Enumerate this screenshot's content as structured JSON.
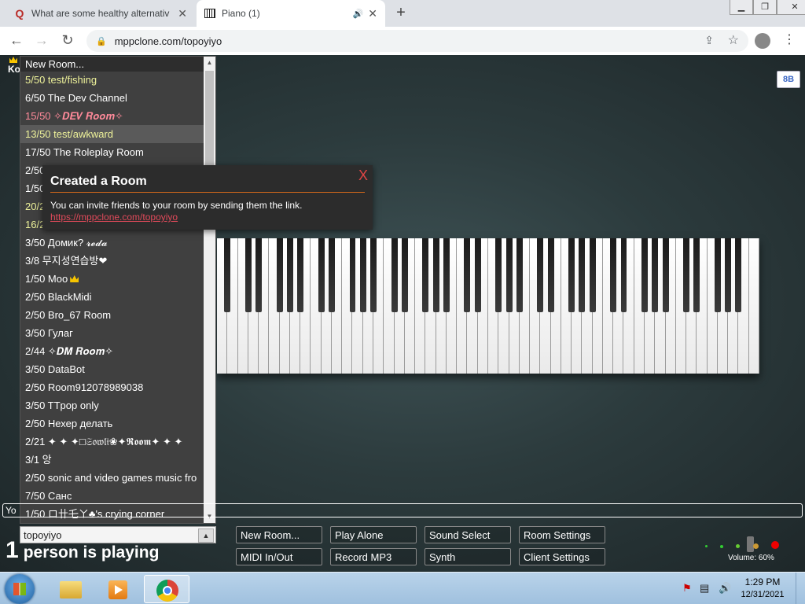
{
  "browser": {
    "tabs": [
      {
        "title": "What are some healthy alternativ",
        "icon": "quora-icon",
        "active": false
      },
      {
        "title": "Piano (1)",
        "icon": "piano-icon",
        "active": true,
        "audio": true
      }
    ],
    "url": "mppclone.com/topoyiyo",
    "window_controls": {
      "minimize": "▁",
      "maximize": "❐",
      "close": "✕"
    }
  },
  "page": {
    "owner_abbrev": "Ko",
    "top_right_button": "8B",
    "rooms": {
      "header": "New Room...",
      "items": [
        {
          "label": "5/50 test/fishing",
          "color": "#eef29a"
        },
        {
          "label": "6/50 The Dev Channel",
          "color": "#ffffff"
        },
        {
          "label": "15/50 ✧𝑫𝑬𝑽 𝑹𝒐𝒐𝒎✧",
          "color": "#ff8a9a"
        },
        {
          "label": "13/50 test/awkward",
          "color": "#eef29a",
          "highlight": true
        },
        {
          "label": "17/50 The Roleplay Room",
          "color": "#ffffff"
        },
        {
          "label": "2/50",
          "color": "#ffffff"
        },
        {
          "label": "1/50",
          "color": "#ffffff"
        },
        {
          "label": "20/2",
          "color": "#eef29a"
        },
        {
          "label": "16/2",
          "color": "#eef29a"
        },
        {
          "label": "3/50 Домик? 𝓻𝓮𝓭𝓪",
          "color": "#ffffff"
        },
        {
          "label": "3/8 무지성연습방❤",
          "color": "#ffffff"
        },
        {
          "label": "1/50 Moo",
          "color": "#ffffff",
          "crown": true
        },
        {
          "label": "2/50 BlackMidi",
          "color": "#ffffff"
        },
        {
          "label": "2/50 Bro_67 Room",
          "color": "#ffffff"
        },
        {
          "label": "3/50 Гулаг",
          "color": "#ffffff"
        },
        {
          "label": "2/44 ✧𝑫𝑴 𝑹𝒐𝒐𝒎✧",
          "color": "#ffffff"
        },
        {
          "label": "3/50 DataBot",
          "color": "#ffffff"
        },
        {
          "label": "2/50 Room912078989038",
          "color": "#ffffff"
        },
        {
          "label": "3/50 TTpop only",
          "color": "#ffffff"
        },
        {
          "label": "2/50 Нехер делать",
          "color": "#ffffff"
        },
        {
          "label": "2/21 ✦ ✦ ✦□𝔖𝔬𝔴𝔩𝔦❀✦𝕽𝖔𝖔𝖒✦ ✦ ✦",
          "color": "#ffffff"
        },
        {
          "label": "3/1 앙",
          "color": "#ffffff"
        },
        {
          "label": "2/50 sonic and video games music fro",
          "color": "#ffffff"
        },
        {
          "label": "7/50 Санс",
          "color": "#ffffff"
        },
        {
          "label": "1/50 ロ卄乇ㄚ♣'s crying corner",
          "color": "#ffffff"
        }
      ]
    },
    "notification": {
      "title": "Created a Room",
      "close_label": "X",
      "message": "You can invite friends to your room by sending them the link.",
      "link": "https://mppclone.com/topoyiyo"
    },
    "chat_prefix": "Yo",
    "room_name_value": "topoyiyo",
    "playing_count": "1",
    "playing_text": "person is playing",
    "buttons": {
      "new_room": "New Room...",
      "play_alone": "Play Alone",
      "sound_select": "Sound Select",
      "room_settings": "Room Settings",
      "midi": "MIDI In/Out",
      "record": "Record MP3",
      "synth": "Synth",
      "client_settings": "Client Settings"
    },
    "volume_label": "Volume: 60%",
    "volume": 0.6,
    "accent_link_color": "#e04a5a"
  },
  "taskbar": {
    "time": "1:29 PM",
    "date": "12/31/2021"
  }
}
